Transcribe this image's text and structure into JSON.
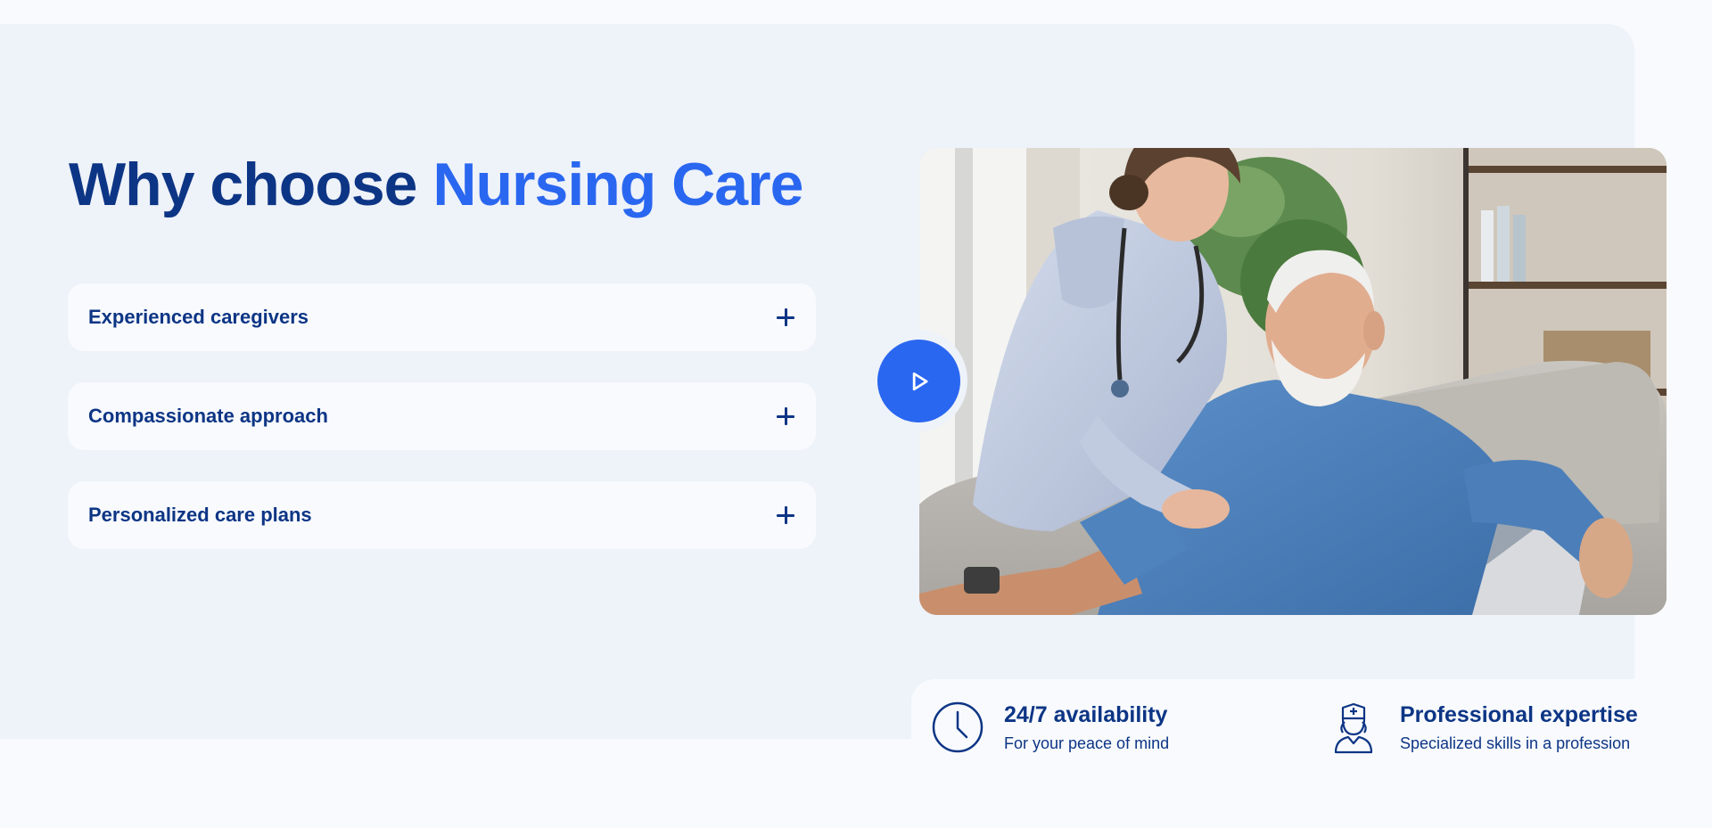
{
  "section": {
    "title_part1": "Why choose ",
    "title_accent": "Nursing Care"
  },
  "accordion": [
    {
      "label": "Experienced caregivers",
      "expanded": false
    },
    {
      "label": "Compassionate approach",
      "expanded": false
    },
    {
      "label": "Personalized care plans",
      "expanded": false
    }
  ],
  "media": {
    "image_subject": "nurse-caring-for-elderly-man",
    "play_icon": "play-icon"
  },
  "features": [
    {
      "icon": "clock-icon",
      "title": "24/7 availability",
      "description": "For your peace of mind"
    },
    {
      "icon": "nurse-icon",
      "title": "Professional expertise",
      "description": "Specialized skills in a profession"
    }
  ],
  "colors": {
    "primary_dark": "#0d3585",
    "accent_blue": "#2a67f0",
    "panel_bg": "#eef2f9",
    "page_bg": "#f8fafd"
  }
}
